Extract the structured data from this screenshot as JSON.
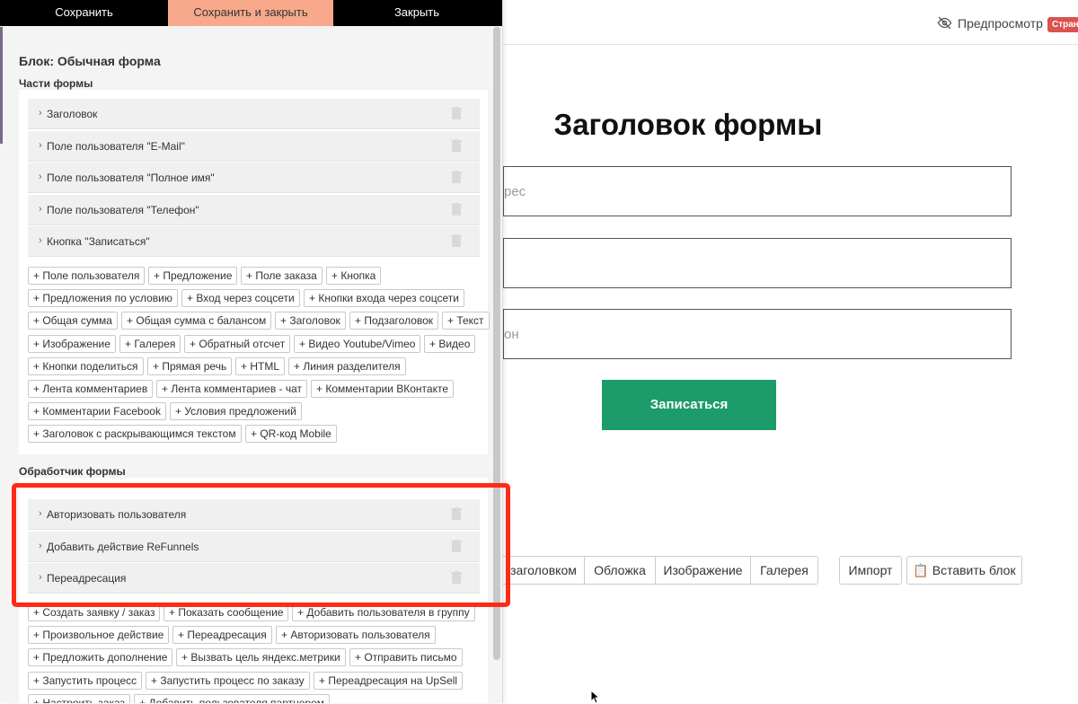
{
  "panel": {
    "top_buttons": {
      "save": "Сохранить",
      "save_close": "Сохранить и закрыть",
      "close": "Закрыть"
    },
    "block_title": "Блок: Обычная форма",
    "parts_label": "Части формы",
    "parts": [
      {
        "label": "Заголовок"
      },
      {
        "label": "Поле пользователя \"E-Mail\""
      },
      {
        "label": "Поле пользователя \"Полное имя\""
      },
      {
        "label": "Поле пользователя \"Телефон\""
      },
      {
        "label": "Кнопка \"Записаться\""
      }
    ],
    "add_parts": [
      "+ Поле пользователя",
      "+ Предложение",
      "+ Поле заказа",
      "+ Кнопка",
      "+ Предложения по условию",
      "+ Вход через соцсети",
      "+ Кнопки входа через соцсети",
      "+ Общая сумма",
      "+ Общая сумма с балансом",
      "+ Заголовок",
      "+ Подзаголовок",
      "+ Текст",
      "+ Изображение",
      "+ Галерея",
      "+ Обратный отсчет",
      "+ Видео Youtube/Vimeo",
      "+ Видео",
      "+ Кнопки поделиться",
      "+ Прямая речь",
      "+ HTML",
      "+ Линия разделителя",
      "+ Лента комментариев",
      "+ Лента комментариев - чат",
      "+ Комментарии ВКонтакте",
      "+ Комментарии Facebook",
      "+ Условия предложений",
      "+ Заголовок с раскрывающимся текстом",
      "+ QR-код Mobile"
    ],
    "handler_label": "Обработчик формы",
    "handlers": [
      {
        "label": "Авторизовать пользователя"
      },
      {
        "label": "Добавить действие ReFunnels"
      },
      {
        "label": "Переадресация"
      }
    ],
    "add_handlers": [
      "+ Создать заявку / заказ",
      "+ Показать сообщение",
      "+ Добавить пользователя в группу",
      "+ Произвольное действие",
      "+ Переадресация",
      "+ Авторизовать пользователя",
      "+ Предложить дополнение",
      "+ Вызвать цель яндекс.метрики",
      "+ Отправить письмо",
      "+ Запустить процесс",
      "+ Запустить процесс по заказу",
      "+ Переадресация на UpSell",
      "+ Настроить заказ",
      "+ Добавить пользователя партнером"
    ]
  },
  "canvas": {
    "preview_label": "Предпросмотр",
    "pages_badge": "Стран",
    "form_title": "Заголовок формы",
    "inputs": [
      {
        "placeholder": "рес"
      },
      {
        "placeholder": ""
      },
      {
        "placeholder": "он"
      }
    ],
    "submit_label": "Записаться",
    "toolbar": {
      "segments": [
        "заголовком",
        "Обложка",
        "Изображение",
        "Галерея"
      ],
      "import_label": "Импорт",
      "paste_label": "Вставить блок"
    }
  },
  "colors": {
    "accent_save_close": "#f8a98b",
    "submit_green": "#1d9c6b",
    "highlight_red": "#ff2a17",
    "badge_red": "#d9534f"
  }
}
